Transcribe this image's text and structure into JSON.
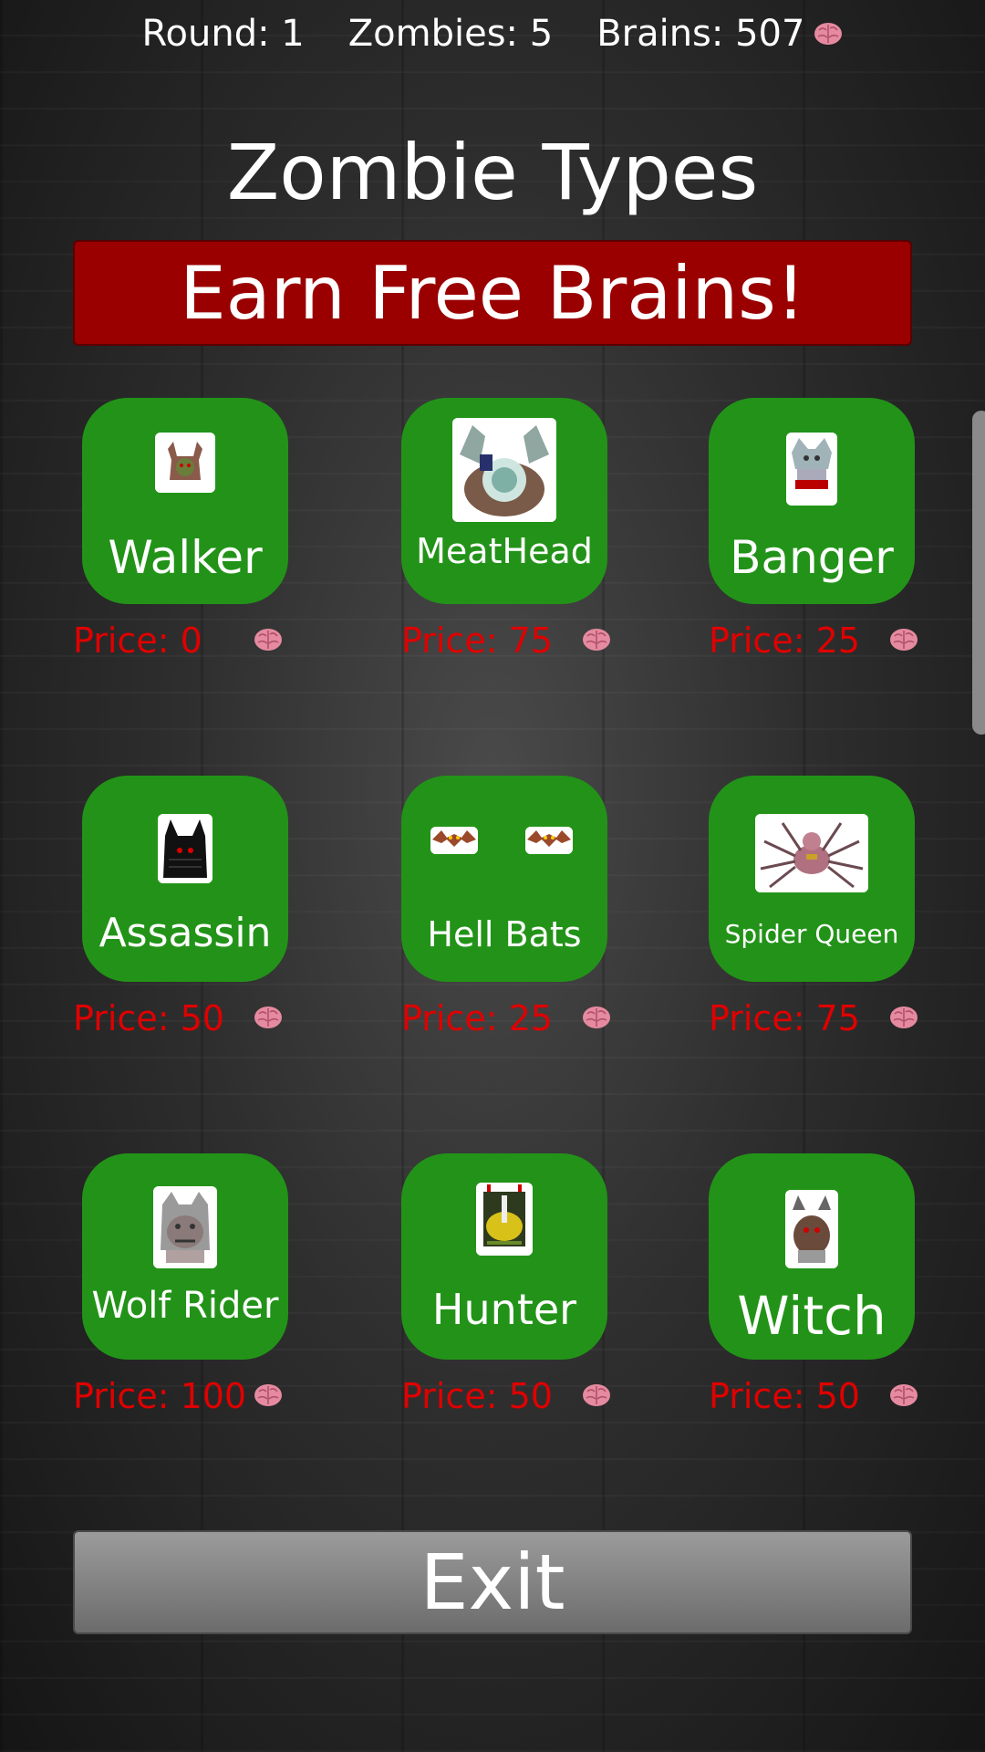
{
  "status": {
    "round": "Round: 1",
    "zombies": "Zombies: 5",
    "brains": "Brains: 507"
  },
  "title": "Zombie Types",
  "earn_button": "Earn Free Brains!",
  "zombies": [
    {
      "name": "Walker",
      "price": "Price: 0"
    },
    {
      "name": "MeatHead",
      "price": "Price: 75"
    },
    {
      "name": "Banger",
      "price": "Price: 25"
    },
    {
      "name": "Assassin",
      "price": "Price: 50"
    },
    {
      "name": "Hell Bats",
      "price": "Price: 25"
    },
    {
      "name": "Spider Queen",
      "price": "Price: 75"
    },
    {
      "name": "Wolf Rider",
      "price": "Price: 100"
    },
    {
      "name": "Hunter",
      "price": "Price: 50"
    },
    {
      "name": "Witch",
      "price": "Price: 50"
    }
  ],
  "exit_button": "Exit",
  "colors": {
    "card_green": "#229318",
    "earn_red": "#9a0000",
    "price_red": "#e00000",
    "brain_pink": "#e58aa0"
  }
}
